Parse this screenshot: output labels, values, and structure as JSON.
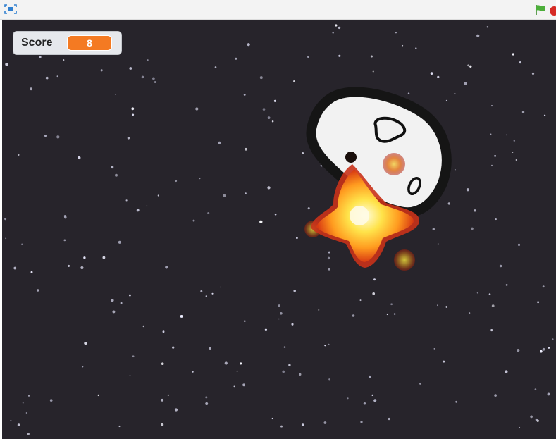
{
  "toolbar": {
    "fullscreen_icon": "fullscreen-icon",
    "green_flag_icon": "green-flag-icon",
    "stop_icon": "stop-sign-icon",
    "colors": {
      "flag": "#4cae3a",
      "stop": "#d62b25",
      "fullscreen": "#2f7fd0"
    }
  },
  "stage": {
    "background_color": "#27242b",
    "sprites": [
      "asteroid",
      "explosion"
    ]
  },
  "score_monitor": {
    "label": "Score",
    "value": "8",
    "value_color": "#f47a22"
  }
}
